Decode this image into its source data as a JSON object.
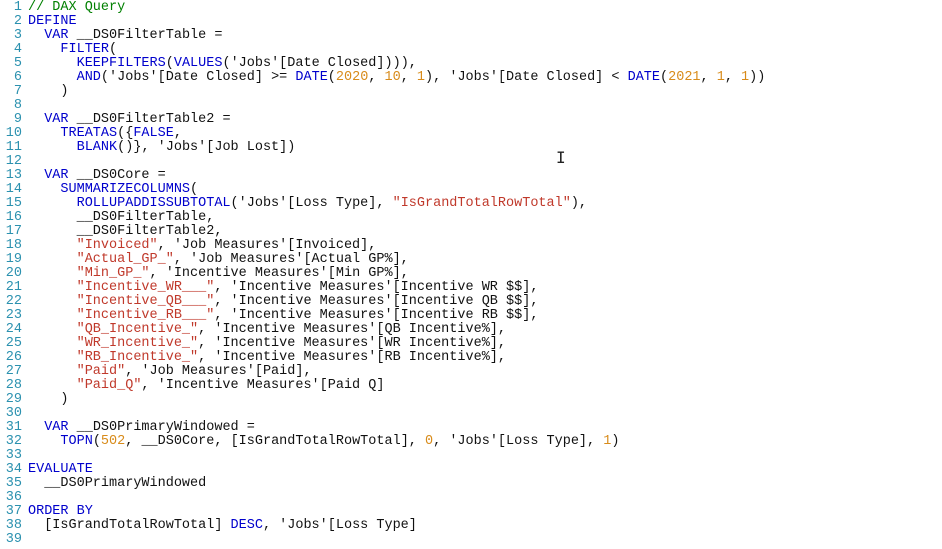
{
  "lines": [
    {
      "n": 1,
      "tokens": [
        [
          "comment",
          "// DAX Query"
        ]
      ]
    },
    {
      "n": 2,
      "tokens": [
        [
          "keyword",
          "DEFINE"
        ]
      ]
    },
    {
      "n": 3,
      "tokens": [
        [
          "ident",
          "  "
        ],
        [
          "keyword",
          "VAR"
        ],
        [
          "ident",
          " "
        ],
        [
          "var",
          "__DS0FilterTable"
        ],
        [
          "ident",
          " "
        ],
        [
          "punct",
          "="
        ]
      ]
    },
    {
      "n": 4,
      "tokens": [
        [
          "ident",
          "    "
        ],
        [
          "func",
          "FILTER"
        ],
        [
          "punct",
          "("
        ]
      ]
    },
    {
      "n": 5,
      "tokens": [
        [
          "ident",
          "      "
        ],
        [
          "func",
          "KEEPFILTERS"
        ],
        [
          "punct",
          "("
        ],
        [
          "func",
          "VALUES"
        ],
        [
          "punct",
          "("
        ],
        [
          "ident",
          "'Jobs'"
        ],
        [
          "col",
          "[Date Closed]"
        ],
        [
          "punct",
          "))"
        ],
        [
          "punct",
          "),"
        ]
      ]
    },
    {
      "n": 6,
      "tokens": [
        [
          "ident",
          "      "
        ],
        [
          "func",
          "AND"
        ],
        [
          "punct",
          "("
        ],
        [
          "ident",
          "'Jobs'"
        ],
        [
          "col",
          "[Date Closed]"
        ],
        [
          "ident",
          " "
        ],
        [
          "punct",
          ">="
        ],
        [
          "ident",
          " "
        ],
        [
          "func",
          "DATE"
        ],
        [
          "punct",
          "("
        ],
        [
          "number",
          "2020"
        ],
        [
          "punct",
          ", "
        ],
        [
          "number",
          "10"
        ],
        [
          "punct",
          ", "
        ],
        [
          "number",
          "1"
        ],
        [
          "punct",
          "), "
        ],
        [
          "ident",
          "'Jobs'"
        ],
        [
          "col",
          "[Date Closed]"
        ],
        [
          "ident",
          " "
        ],
        [
          "punct",
          "<"
        ],
        [
          "ident",
          " "
        ],
        [
          "func",
          "DATE"
        ],
        [
          "punct",
          "("
        ],
        [
          "number",
          "2021"
        ],
        [
          "punct",
          ", "
        ],
        [
          "number",
          "1"
        ],
        [
          "punct",
          ", "
        ],
        [
          "number",
          "1"
        ],
        [
          "punct",
          "))"
        ]
      ]
    },
    {
      "n": 7,
      "tokens": [
        [
          "ident",
          "    "
        ],
        [
          "punct",
          ")"
        ]
      ]
    },
    {
      "n": 8,
      "tokens": [
        [
          "ident",
          ""
        ]
      ]
    },
    {
      "n": 9,
      "tokens": [
        [
          "ident",
          "  "
        ],
        [
          "keyword",
          "VAR"
        ],
        [
          "ident",
          " "
        ],
        [
          "var",
          "__DS0FilterTable2"
        ],
        [
          "ident",
          " "
        ],
        [
          "punct",
          "="
        ]
      ]
    },
    {
      "n": 10,
      "tokens": [
        [
          "ident",
          "    "
        ],
        [
          "func",
          "TREATAS"
        ],
        [
          "punct",
          "({"
        ],
        [
          "blue",
          "FALSE"
        ],
        [
          "punct",
          ","
        ]
      ]
    },
    {
      "n": 11,
      "tokens": [
        [
          "ident",
          "      "
        ],
        [
          "func",
          "BLANK"
        ],
        [
          "punct",
          "()}"
        ],
        [
          "punct",
          ", "
        ],
        [
          "ident",
          "'Jobs'"
        ],
        [
          "col",
          "[Job Lost]"
        ],
        [
          "punct",
          ")"
        ]
      ]
    },
    {
      "n": 12,
      "tokens": [
        [
          "ident",
          ""
        ]
      ]
    },
    {
      "n": 13,
      "tokens": [
        [
          "ident",
          "  "
        ],
        [
          "keyword",
          "VAR"
        ],
        [
          "ident",
          " "
        ],
        [
          "var",
          "__DS0Core"
        ],
        [
          "ident",
          " "
        ],
        [
          "punct",
          "="
        ]
      ]
    },
    {
      "n": 14,
      "tokens": [
        [
          "ident",
          "    "
        ],
        [
          "func",
          "SUMMARIZECOLUMNS"
        ],
        [
          "punct",
          "("
        ]
      ]
    },
    {
      "n": 15,
      "tokens": [
        [
          "ident",
          "      "
        ],
        [
          "func",
          "ROLLUPADDISSUBTOTAL"
        ],
        [
          "punct",
          "("
        ],
        [
          "ident",
          "'Jobs'"
        ],
        [
          "col",
          "[Loss Type]"
        ],
        [
          "punct",
          ", "
        ],
        [
          "redstr",
          "\"IsGrandTotalRowTotal\""
        ],
        [
          "punct",
          "),"
        ]
      ]
    },
    {
      "n": 16,
      "tokens": [
        [
          "ident",
          "      "
        ],
        [
          "var",
          "__DS0FilterTable"
        ],
        [
          "punct",
          ","
        ]
      ]
    },
    {
      "n": 17,
      "tokens": [
        [
          "ident",
          "      "
        ],
        [
          "var",
          "__DS0FilterTable2"
        ],
        [
          "punct",
          ","
        ]
      ]
    },
    {
      "n": 18,
      "tokens": [
        [
          "ident",
          "      "
        ],
        [
          "redstr",
          "\"Invoiced\""
        ],
        [
          "punct",
          ", "
        ],
        [
          "ident",
          "'Job Measures'"
        ],
        [
          "col",
          "[Invoiced]"
        ],
        [
          "punct",
          ","
        ]
      ]
    },
    {
      "n": 19,
      "tokens": [
        [
          "ident",
          "      "
        ],
        [
          "redstr",
          "\"Actual_GP_\""
        ],
        [
          "punct",
          ", "
        ],
        [
          "ident",
          "'Job Measures'"
        ],
        [
          "col",
          "[Actual GP%]"
        ],
        [
          "punct",
          ","
        ]
      ]
    },
    {
      "n": 20,
      "tokens": [
        [
          "ident",
          "      "
        ],
        [
          "redstr",
          "\"Min_GP_\""
        ],
        [
          "punct",
          ", "
        ],
        [
          "ident",
          "'Incentive Measures'"
        ],
        [
          "col",
          "[Min GP%]"
        ],
        [
          "punct",
          ","
        ]
      ]
    },
    {
      "n": 21,
      "tokens": [
        [
          "ident",
          "      "
        ],
        [
          "redstr",
          "\"Incentive_WR___\""
        ],
        [
          "punct",
          ", "
        ],
        [
          "ident",
          "'Incentive Measures'"
        ],
        [
          "col",
          "[Incentive WR $$]"
        ],
        [
          "punct",
          ","
        ]
      ]
    },
    {
      "n": 22,
      "tokens": [
        [
          "ident",
          "      "
        ],
        [
          "redstr",
          "\"Incentive_QB___\""
        ],
        [
          "punct",
          ", "
        ],
        [
          "ident",
          "'Incentive Measures'"
        ],
        [
          "col",
          "[Incentive QB $$]"
        ],
        [
          "punct",
          ","
        ]
      ]
    },
    {
      "n": 23,
      "tokens": [
        [
          "ident",
          "      "
        ],
        [
          "redstr",
          "\"Incentive_RB___\""
        ],
        [
          "punct",
          ", "
        ],
        [
          "ident",
          "'Incentive Measures'"
        ],
        [
          "col",
          "[Incentive RB $$]"
        ],
        [
          "punct",
          ","
        ]
      ]
    },
    {
      "n": 24,
      "tokens": [
        [
          "ident",
          "      "
        ],
        [
          "redstr",
          "\"QB_Incentive_\""
        ],
        [
          "punct",
          ", "
        ],
        [
          "ident",
          "'Incentive Measures'"
        ],
        [
          "col",
          "[QB Incentive%]"
        ],
        [
          "punct",
          ","
        ]
      ]
    },
    {
      "n": 25,
      "tokens": [
        [
          "ident",
          "      "
        ],
        [
          "redstr",
          "\"WR_Incentive_\""
        ],
        [
          "punct",
          ", "
        ],
        [
          "ident",
          "'Incentive Measures'"
        ],
        [
          "col",
          "[WR Incentive%]"
        ],
        [
          "punct",
          ","
        ]
      ]
    },
    {
      "n": 26,
      "tokens": [
        [
          "ident",
          "      "
        ],
        [
          "redstr",
          "\"RB_Incentive_\""
        ],
        [
          "punct",
          ", "
        ],
        [
          "ident",
          "'Incentive Measures'"
        ],
        [
          "col",
          "[RB Incentive%]"
        ],
        [
          "punct",
          ","
        ]
      ]
    },
    {
      "n": 27,
      "tokens": [
        [
          "ident",
          "      "
        ],
        [
          "redstr",
          "\"Paid\""
        ],
        [
          "punct",
          ", "
        ],
        [
          "ident",
          "'Job Measures'"
        ],
        [
          "col",
          "[Paid]"
        ],
        [
          "punct",
          ","
        ]
      ]
    },
    {
      "n": 28,
      "tokens": [
        [
          "ident",
          "      "
        ],
        [
          "redstr",
          "\"Paid_Q\""
        ],
        [
          "punct",
          ", "
        ],
        [
          "ident",
          "'Incentive Measures'"
        ],
        [
          "col",
          "[Paid Q]"
        ]
      ]
    },
    {
      "n": 29,
      "tokens": [
        [
          "ident",
          "    "
        ],
        [
          "punct",
          ")"
        ]
      ]
    },
    {
      "n": 30,
      "tokens": [
        [
          "ident",
          ""
        ]
      ]
    },
    {
      "n": 31,
      "tokens": [
        [
          "ident",
          "  "
        ],
        [
          "keyword",
          "VAR"
        ],
        [
          "ident",
          " "
        ],
        [
          "var",
          "__DS0PrimaryWindowed"
        ],
        [
          "ident",
          " "
        ],
        [
          "punct",
          "="
        ]
      ]
    },
    {
      "n": 32,
      "tokens": [
        [
          "ident",
          "    "
        ],
        [
          "func",
          "TOPN"
        ],
        [
          "punct",
          "("
        ],
        [
          "number",
          "502"
        ],
        [
          "punct",
          ", "
        ],
        [
          "var",
          "__DS0Core"
        ],
        [
          "punct",
          ", "
        ],
        [
          "col",
          "[IsGrandTotalRowTotal]"
        ],
        [
          "punct",
          ", "
        ],
        [
          "number",
          "0"
        ],
        [
          "punct",
          ", "
        ],
        [
          "ident",
          "'Jobs'"
        ],
        [
          "col",
          "[Loss Type]"
        ],
        [
          "punct",
          ", "
        ],
        [
          "number",
          "1"
        ],
        [
          "punct",
          ")"
        ]
      ]
    },
    {
      "n": 33,
      "tokens": [
        [
          "ident",
          ""
        ]
      ]
    },
    {
      "n": 34,
      "tokens": [
        [
          "keyword",
          "EVALUATE"
        ]
      ]
    },
    {
      "n": 35,
      "tokens": [
        [
          "ident",
          "  "
        ],
        [
          "var",
          "__DS0PrimaryWindowed"
        ]
      ]
    },
    {
      "n": 36,
      "tokens": [
        [
          "ident",
          ""
        ]
      ]
    },
    {
      "n": 37,
      "tokens": [
        [
          "keyword",
          "ORDER BY"
        ]
      ]
    },
    {
      "n": 38,
      "tokens": [
        [
          "ident",
          "  "
        ],
        [
          "col",
          "[IsGrandTotalRowTotal]"
        ],
        [
          "ident",
          " "
        ],
        [
          "keyword",
          "DESC"
        ],
        [
          "punct",
          ", "
        ],
        [
          "ident",
          "'Jobs'"
        ],
        [
          "col",
          "[Loss Type]"
        ]
      ]
    },
    {
      "n": 39,
      "tokens": [
        [
          "ident",
          ""
        ]
      ]
    }
  ],
  "caret_glyph": "I",
  "colors": {
    "comment": "#008000",
    "keyword": "#0000cc",
    "function": "#0000cc",
    "identifier": "#111111",
    "string": "#a31515",
    "redstring": "#c0392b",
    "number": "#d88b1a",
    "gutter": "#2b91af",
    "background": "#ffffff"
  }
}
